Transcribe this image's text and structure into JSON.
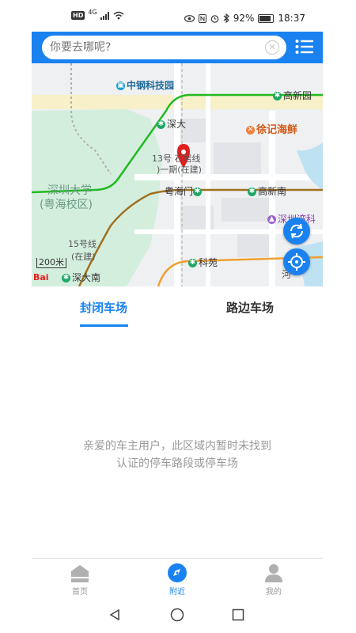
{
  "status_bar": {
    "left_hd": "HD",
    "network": "4G",
    "battery": "92%",
    "time": "18:37"
  },
  "search": {
    "placeholder": "你要去哪呢?"
  },
  "map": {
    "labels": {
      "tech_park": "中钢科技园",
      "station_gaoxinyuan": "高新园",
      "station_shenda": "深大",
      "restaurant": "徐记海鲜",
      "line13": "13号",
      "line13_rest": "石岩线",
      "construction": ")一期(在建)",
      "univ_line1": "深圳大学",
      "univ_line2": "(粤海校区)",
      "station_yuehaimen": "粤海门",
      "station_gaoxinnan": "高新南",
      "mall_line1": "深圳湾科",
      "line15": "15号线",
      "line15_status": "(在建)",
      "station_keyuan": "科苑",
      "station_shendanan": "深大南",
      "river": "河",
      "scale": "200米",
      "logo": "Bai"
    }
  },
  "tabs": [
    {
      "label": "封闭车场"
    },
    {
      "label": "路边车场"
    }
  ],
  "empty_message": {
    "line1": "亲爱的车主用户，此区域内暂时未找到",
    "line2": "认证的停车路段或停车场"
  },
  "bottom_nav": [
    {
      "label": "首页",
      "icon": "home-icon"
    },
    {
      "label": "附近",
      "icon": "compass-icon"
    },
    {
      "label": "我的",
      "icon": "user-icon"
    }
  ],
  "colors": {
    "accent": "#1a82f0",
    "metro_green": "#1ca864",
    "line_green": "#22bb22",
    "line_brown": "#a07020",
    "line_orange": "#f0a030"
  }
}
